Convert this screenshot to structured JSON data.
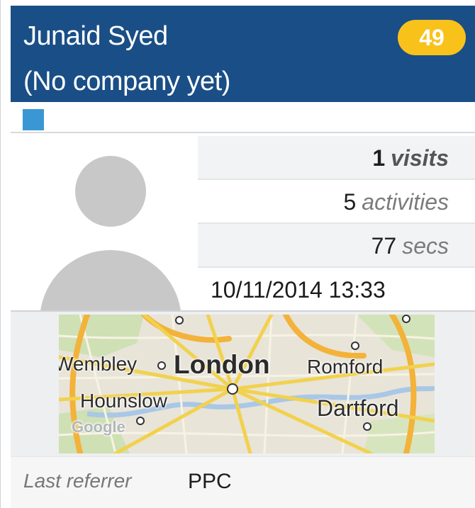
{
  "contact": {
    "name": "Junaid Syed",
    "company": "(No company yet)",
    "score": "49"
  },
  "colors": {
    "header_bg": "#1a4e86",
    "badge_bg": "#f8c21b",
    "tag": "#3a97d3",
    "avatar": "#c8c8c8"
  },
  "stats": {
    "visits": {
      "value": "1",
      "unit": "visits"
    },
    "activities": {
      "value": "5",
      "unit": "activities"
    },
    "time": {
      "value": "77",
      "unit": "secs"
    },
    "last_visit": "10/11/2014 13:33"
  },
  "map": {
    "labels": {
      "wembley": "Wembley",
      "london": "London",
      "romford": "Romford",
      "hounslow": "Hounslow",
      "dartford": "Dartford",
      "google": "Google"
    }
  },
  "footer": {
    "referrer_label": "Last referrer",
    "referrer_value": "PPC"
  }
}
